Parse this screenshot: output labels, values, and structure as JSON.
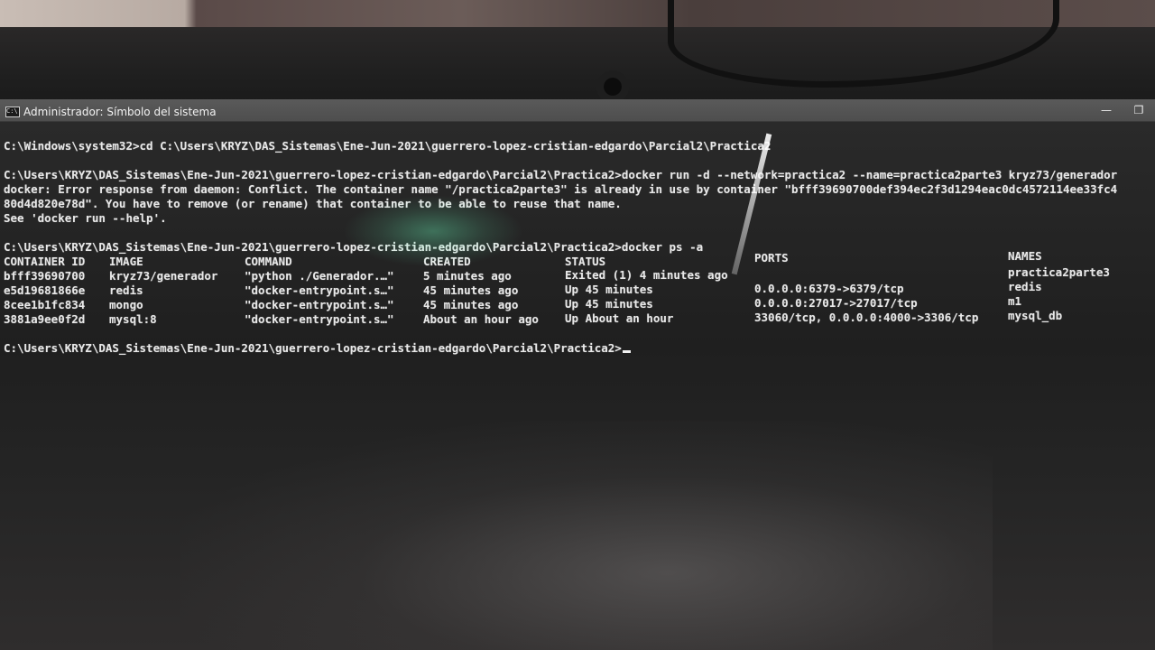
{
  "window": {
    "title": "Administrador: Símbolo del sistema",
    "icon": "cmd-window-icon",
    "icon_text": "C:\\",
    "minimize_glyph": "—",
    "maximize_glyph": "❐"
  },
  "terminal": {
    "lines": [
      "C:\\Windows\\system32>cd C:\\Users\\KRYZ\\DAS_Sistemas\\Ene-Jun-2021\\guerrero-lopez-cristian-edgardo\\Parcial2\\Practica2",
      "C:\\Users\\KRYZ\\DAS_Sistemas\\Ene-Jun-2021\\guerrero-lopez-cristian-edgardo\\Parcial2\\Practica2>docker run -d --network=practica2 --name=practica2parte3 kryz73/generador",
      "docker: Error response from daemon: Conflict. The container name \"/practica2parte3\" is already in use by container \"bfff39690700def394ec2f3d1294eac0dc4572114ee33fc4",
      "80d4d820e78d\". You have to remove (or rename) that container to be able to reuse that name.",
      "See 'docker run --help'.",
      "C:\\Users\\KRYZ\\DAS_Sistemas\\Ene-Jun-2021\\guerrero-lopez-cristian-edgardo\\Parcial2\\Practica2>docker ps -a"
    ],
    "table": {
      "headers": [
        "CONTAINER ID",
        "IMAGE",
        "COMMAND",
        "CREATED",
        "STATUS",
        "PORTS",
        "NAMES"
      ],
      "rows": [
        [
          "bfff39690700",
          "kryz73/generador",
          "\"python ./Generador.…\"",
          "5 minutes ago",
          "Exited (1) 4 minutes ago",
          "",
          "practica2parte3"
        ],
        [
          "e5d19681866e",
          "redis",
          "\"docker-entrypoint.s…\"",
          "45 minutes ago",
          "Up 45 minutes",
          "0.0.0.0:6379->6379/tcp",
          "redis"
        ],
        [
          "8cee1b1fc834",
          "mongo",
          "\"docker-entrypoint.s…\"",
          "45 minutes ago",
          "Up 45 minutes",
          "0.0.0.0:27017->27017/tcp",
          "m1"
        ],
        [
          "3881a9ee0f2d",
          "mysql:8",
          "\"docker-entrypoint.s…\"",
          "About an hour ago",
          "Up About an hour",
          "33060/tcp, 0.0.0.0:4000->3306/tcp",
          "mysql_db"
        ]
      ]
    },
    "prompt": "C:\\Users\\KRYZ\\DAS_Sistemas\\Ene-Jun-2021\\guerrero-lopez-cristian-edgardo\\Parcial2\\Practica2>"
  }
}
